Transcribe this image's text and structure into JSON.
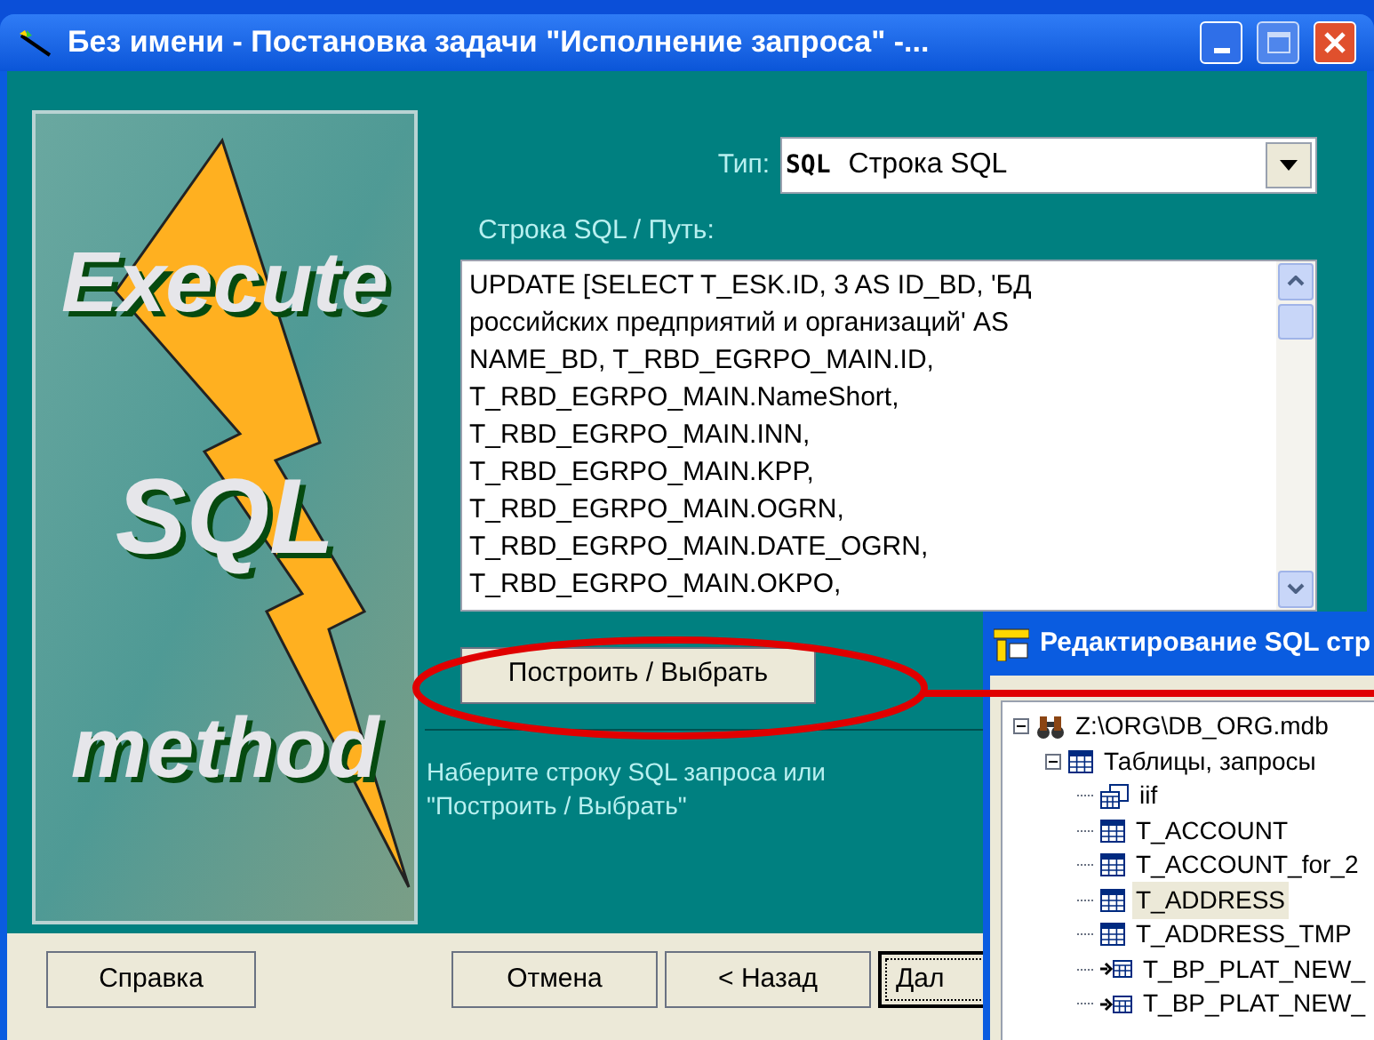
{
  "window": {
    "title": "Без имени - Постановка задачи  \"Исполнение запроса\" -..."
  },
  "banner": {
    "lines": [
      "Execute",
      "SQL",
      "method"
    ]
  },
  "type_field": {
    "label": "Тип:",
    "badge": "SQL",
    "value": "Строка SQL"
  },
  "sql_field": {
    "label": "Строка SQL / Путь:",
    "value": "UPDATE [SELECT T_ESK.ID, 3 AS ID_BD, 'БД\nроссийских предприятий и организаций' AS\nNAME_BD, T_RBD_EGRPO_MAIN.ID,\nT_RBD_EGRPO_MAIN.NameShort,\nT_RBD_EGRPO_MAIN.INN,\nT_RBD_EGRPO_MAIN.KPP,\nT_RBD_EGRPO_MAIN.OGRN,\nT_RBD_EGRPO_MAIN.DATE_OGRN,\nT_RBD_EGRPO_MAIN.OKPO,"
  },
  "build_button": {
    "label": "Построить / Выбрать"
  },
  "hint": "Наберите строку SQL запроса или\n\"Построить / Выбрать\"",
  "buttons": [
    {
      "label": "Справка",
      "kind": "help"
    },
    {
      "label": "Отмена",
      "kind": "nav"
    },
    {
      "label": "< Назад",
      "kind": "nav"
    },
    {
      "label": "Дал",
      "kind": "default"
    }
  ],
  "editor_window": {
    "title": "Редактирование SQL стр",
    "tree": [
      {
        "label": "Z:\\ORG\\DB_ORG.mdb",
        "kind": "database",
        "expanded": true,
        "selected": false,
        "children": [
          {
            "label": "Таблицы, запросы",
            "kind": "group",
            "expanded": true,
            "selected": false,
            "children": [
              {
                "label": "iif",
                "kind": "query",
                "selected": false
              },
              {
                "label": "T_ACCOUNT",
                "kind": "table",
                "selected": false
              },
              {
                "label": "T_ACCOUNT_for_2",
                "kind": "table",
                "selected": false
              },
              {
                "label": "T_ADDRESS",
                "kind": "table",
                "selected": true
              },
              {
                "label": "T_ADDRESS_TMP",
                "kind": "table",
                "selected": false
              },
              {
                "label": "T_BP_PLAT_NEW_",
                "kind": "linked",
                "selected": false
              },
              {
                "label": "T_BP_PLAT_NEW_",
                "kind": "linked",
                "selected": false
              }
            ]
          }
        ]
      }
    ]
  }
}
